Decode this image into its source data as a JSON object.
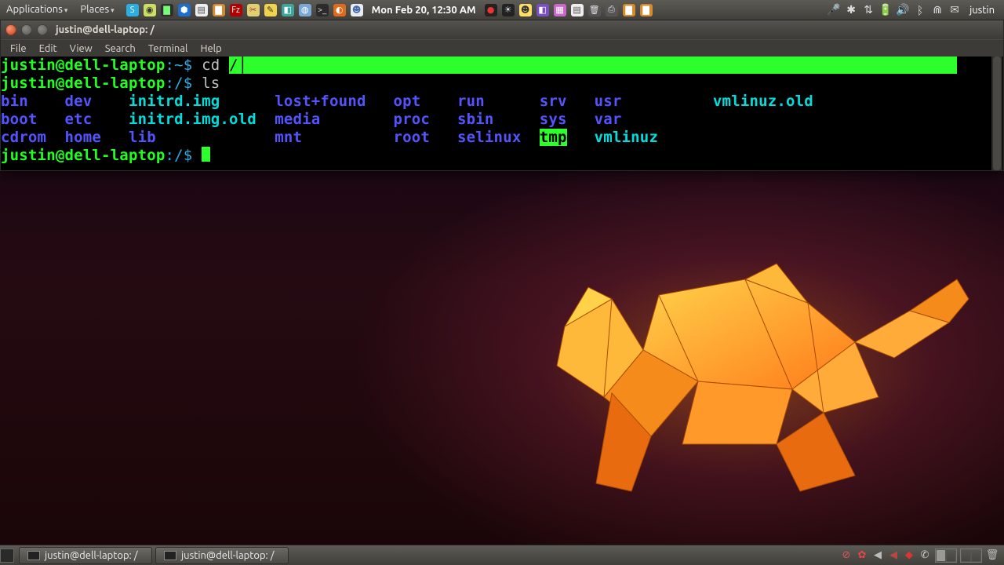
{
  "top_panel": {
    "menu_applications": "Applications",
    "menu_places": "Places",
    "clock": "Mon Feb 20, 12:30 AM",
    "user": "justin",
    "launchers": [
      {
        "name": "skype-icon",
        "bg": "#2baee4",
        "fg": "#fff",
        "txt": "S"
      },
      {
        "name": "generic-yel-icon",
        "bg": "#cbe063",
        "fg": "#333",
        "txt": "◉"
      },
      {
        "name": "monitor-icon",
        "bg": "#2e2e2e",
        "fg": "#7f7",
        "txt": "▇"
      },
      {
        "name": "dropbox-icon",
        "bg": "#1a6fd1",
        "fg": "#fff",
        "txt": "⬢"
      },
      {
        "name": "doc-icon",
        "bg": "#eeeeee",
        "fg": "#555",
        "txt": "▤"
      },
      {
        "name": "folder-icon",
        "bg": "#d48b2e",
        "fg": "#fff",
        "txt": "▇"
      },
      {
        "name": "filezilla-icon",
        "bg": "#b30000",
        "fg": "#fff",
        "txt": "Fz"
      },
      {
        "name": "scissors-icon",
        "bg": "#e0d070",
        "fg": "#a33",
        "txt": "✂"
      },
      {
        "name": "notes-icon",
        "bg": "#f3d24c",
        "fg": "#333",
        "txt": "✎"
      },
      {
        "name": "teal-app-icon",
        "bg": "#3aa79a",
        "fg": "#fff",
        "txt": "◧"
      },
      {
        "name": "blue-globe-icon",
        "bg": "#7aa7d8",
        "fg": "#fff",
        "txt": "◍"
      },
      {
        "name": "terminal-icon",
        "bg": "#2b2b2b",
        "fg": "#ddd",
        "txt": ">_"
      },
      {
        "name": "firefox-icon",
        "bg": "#e06a1a",
        "fg": "#fff",
        "txt": "◐"
      },
      {
        "name": "chat-icon",
        "bg": "#e9edf2",
        "fg": "#46a",
        "txt": "☻"
      }
    ],
    "tray_right_icons": [
      {
        "name": "recorder-icon",
        "bg": "#222",
        "fg": "#e33",
        "txt": "●"
      },
      {
        "name": "weather-icon",
        "bg": "#222",
        "fg": "#ddd",
        "txt": "☀"
      },
      {
        "name": "emoji-icon",
        "bg": "#fd6",
        "fg": "#333",
        "txt": "☻"
      },
      {
        "name": "purple-app-icon",
        "bg": "#7a4fc1",
        "fg": "#fff",
        "txt": "◧"
      },
      {
        "name": "grid-icon",
        "bg": "#c868c8",
        "fg": "#fff",
        "txt": "▦"
      },
      {
        "name": "page-icon",
        "bg": "#eee",
        "fg": "#555",
        "txt": "▤"
      },
      {
        "name": "trash-icon",
        "bg": "#555",
        "fg": "#ddd",
        "txt": "🗑"
      },
      {
        "name": "printer-icon",
        "bg": "#555",
        "fg": "#ddd",
        "txt": "⎙"
      },
      {
        "name": "folder2-icon",
        "bg": "#d48b2e",
        "fg": "#fff",
        "txt": "▇"
      },
      {
        "name": "folder3-icon",
        "bg": "#d48b2e",
        "fg": "#fff",
        "txt": "▇"
      }
    ],
    "sys_icons": [
      {
        "name": "mic-icon",
        "glyph": "🎤"
      },
      {
        "name": "bluetooth-2-icon",
        "glyph": "✱"
      },
      {
        "name": "arrows-icon",
        "glyph": "⇅"
      },
      {
        "name": "battery-icon",
        "glyph": "🔋"
      },
      {
        "name": "volume-icon",
        "glyph": "🔊"
      },
      {
        "name": "bluetooth-icon",
        "glyph": "ᛒ"
      },
      {
        "name": "wifi-icon",
        "glyph": "⋒"
      },
      {
        "name": "mail-icon",
        "glyph": "✉"
      }
    ]
  },
  "terminal": {
    "title": "justin@dell-laptop: /",
    "menu": {
      "file": "File",
      "edit": "Edit",
      "view": "View",
      "search": "Search",
      "terminal": "Terminal",
      "help": "Help"
    },
    "line1": {
      "prompt_user": "justin@dell-laptop",
      "prompt_path": ":~$ ",
      "cmd": "cd ",
      "sel": "/"
    },
    "line2": {
      "prompt_user": "justin@dell-laptop",
      "prompt_path": ":/$ ",
      "cmd": "ls "
    },
    "ls": {
      "r1": {
        "c1": "bin   ",
        "c2": "dev   ",
        "c3": "initrd.img     ",
        "c4": "lost+found  ",
        "c5": "opt   ",
        "c6": "run     ",
        "c7": "srv  ",
        "c8": "usr         ",
        "c9": "vmlinuz.old"
      },
      "r2": {
        "c1": "boot  ",
        "c2": "etc   ",
        "c3": "initrd.img.old ",
        "c4": "media       ",
        "c5": "proc  ",
        "c6": "sbin    ",
        "c7": "sys  ",
        "c8": "var"
      },
      "r3": {
        "c1": "cdrom ",
        "c2": "home  ",
        "c3": "lib            ",
        "c4": "mnt         ",
        "c5": "root  ",
        "c6": "selinux ",
        "c7t": "tmp",
        "c7s": "  ",
        "c8": "vmlinuz"
      }
    },
    "line6": {
      "prompt_user": "justin@dell-laptop",
      "prompt_path": ":/$ "
    }
  },
  "bottom_panel": {
    "task1": "justin@dell-laptop: /",
    "task2": "justin@dell-laptop: /",
    "right_icons": [
      {
        "name": "nosign-icon",
        "glyph": "⊘",
        "color": "#d55"
      },
      {
        "name": "red-app-icon",
        "glyph": "✿",
        "color": "#e44"
      },
      {
        "name": "v1-icon",
        "glyph": "◀",
        "color": "#bbb"
      },
      {
        "name": "v2-icon",
        "glyph": "◀",
        "color": "#b44"
      },
      {
        "name": "red-sq-icon",
        "glyph": "◆",
        "color": "#d33"
      },
      {
        "name": "phone-icon",
        "glyph": "✆",
        "color": "#ccc"
      }
    ]
  }
}
